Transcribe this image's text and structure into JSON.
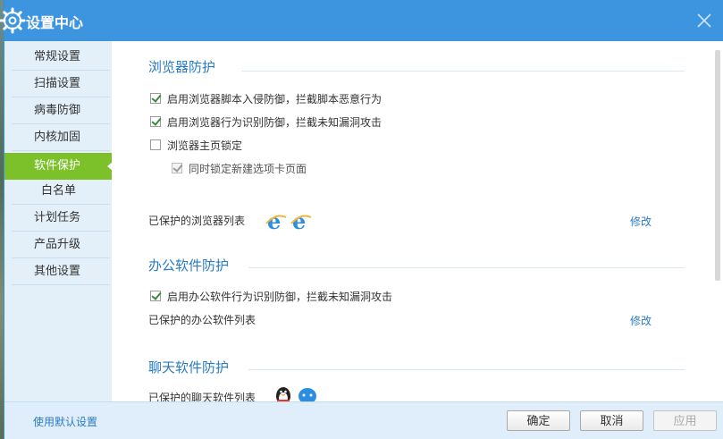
{
  "window": {
    "title": "设置中心"
  },
  "sidebar": {
    "items": [
      {
        "label": "常规设置",
        "active": false
      },
      {
        "label": "扫描设置",
        "active": false
      },
      {
        "label": "病毒防御",
        "active": false
      },
      {
        "label": "内核加固",
        "active": false
      },
      {
        "label": "软件保护",
        "active": true
      },
      {
        "label": "白名单",
        "active": false
      },
      {
        "label": "计划任务",
        "active": false
      },
      {
        "label": "产品升级",
        "active": false
      },
      {
        "label": "其他设置",
        "active": false
      }
    ]
  },
  "browser_section": {
    "title": "浏览器防护",
    "options": [
      {
        "label": "启用浏览器脚本入侵防御，拦截脚本恶意行为",
        "checked": true,
        "disabled": false
      },
      {
        "label": "启用浏览器行为识别防御，拦截未知漏洞攻击",
        "checked": true,
        "disabled": false
      },
      {
        "label": "浏览器主页锁定",
        "checked": false,
        "disabled": false
      },
      {
        "label": "同时锁定新建选项卡页面",
        "checked": true,
        "disabled": true
      }
    ],
    "protected_label": "已保护的浏览器列表",
    "protected_icons": [
      "ie-browser-icon",
      "ie-browser-icon"
    ],
    "modify_label": "修改"
  },
  "office_section": {
    "title": "办公软件防护",
    "options": [
      {
        "label": "启用办公软件行为识别防御，拦截未知漏洞攻击",
        "checked": true,
        "disabled": false
      }
    ],
    "protected_label": "已保护的办公软件列表",
    "modify_label": "修改"
  },
  "chat_section": {
    "title": "聊天软件防护",
    "protected_label": "已保护的聊天软件列表",
    "protected_icons": [
      "qq-penguin-icon",
      "chat-bubble-icon"
    ]
  },
  "footer": {
    "default_link": "使用默认设置",
    "ok_label": "确定",
    "cancel_label": "取消",
    "apply_label": "应用"
  },
  "colors": {
    "titlebar": "#3d95e0",
    "accent_green": "#7cc12a",
    "link_blue": "#2a7bc4",
    "sidebar_bg": "#e3f0fa"
  }
}
